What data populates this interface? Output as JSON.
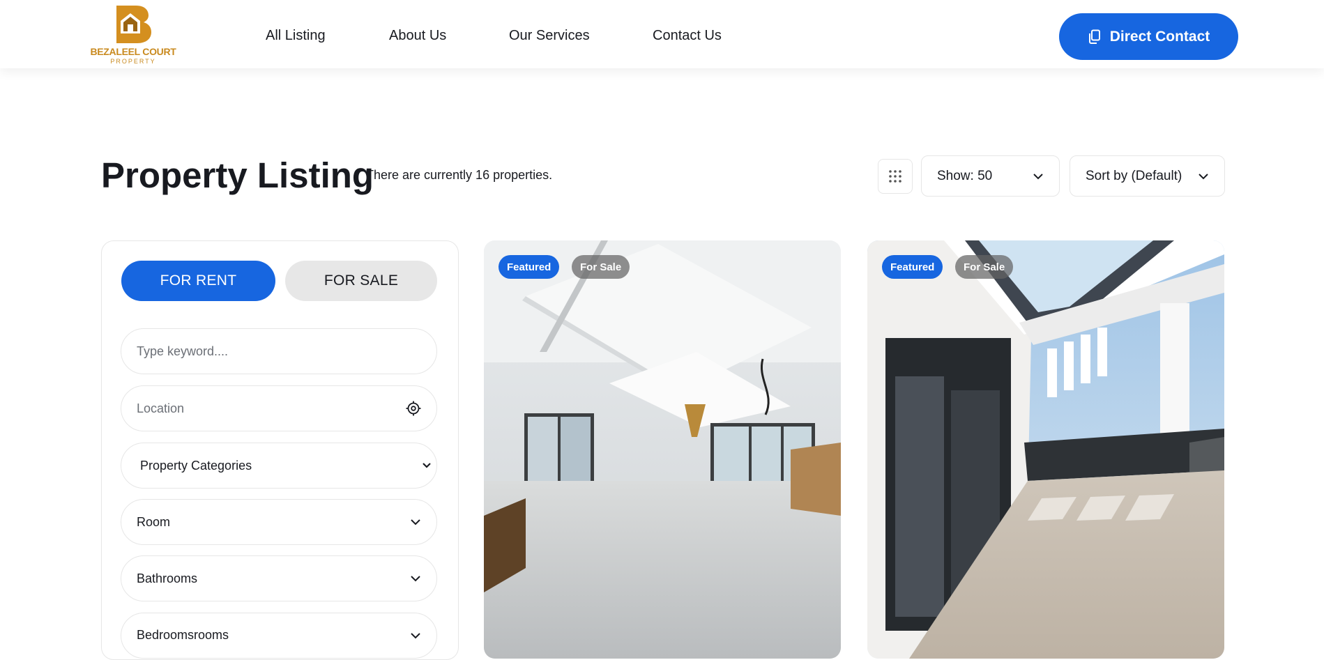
{
  "header": {
    "logo": {
      "name": "BEZALEEL COURT",
      "sub": "PROPERTY"
    },
    "nav": [
      "All Listing",
      "About Us",
      "Our Services",
      "Contact Us"
    ],
    "cta": {
      "label": "Direct Contact",
      "icon": "copy-icon"
    }
  },
  "listing": {
    "title": "Property Listing",
    "count_text": "There are currently 16 properties.",
    "show_select": "Show: 50",
    "sort_select": "Sort by (Default)"
  },
  "filters": {
    "tabs": [
      "FOR RENT",
      "FOR SALE"
    ],
    "active_tab": "FOR RENT",
    "keyword_placeholder": "Type keyword....",
    "location_placeholder": "Location",
    "category_select": "Property Categories",
    "room_select": "Room",
    "bathrooms_select": "Bathrooms",
    "bedrooms_select": "Bedroomsrooms"
  },
  "cards": [
    {
      "badges": [
        "Featured",
        "For Sale"
      ],
      "image": "interior-living-room"
    },
    {
      "badges": [
        "Featured",
        "For Sale"
      ],
      "image": "rooftop-terrace"
    }
  ],
  "colors": {
    "accent": "#1766e0",
    "logo_gold": "#c98a1f",
    "text": "#181a20"
  }
}
